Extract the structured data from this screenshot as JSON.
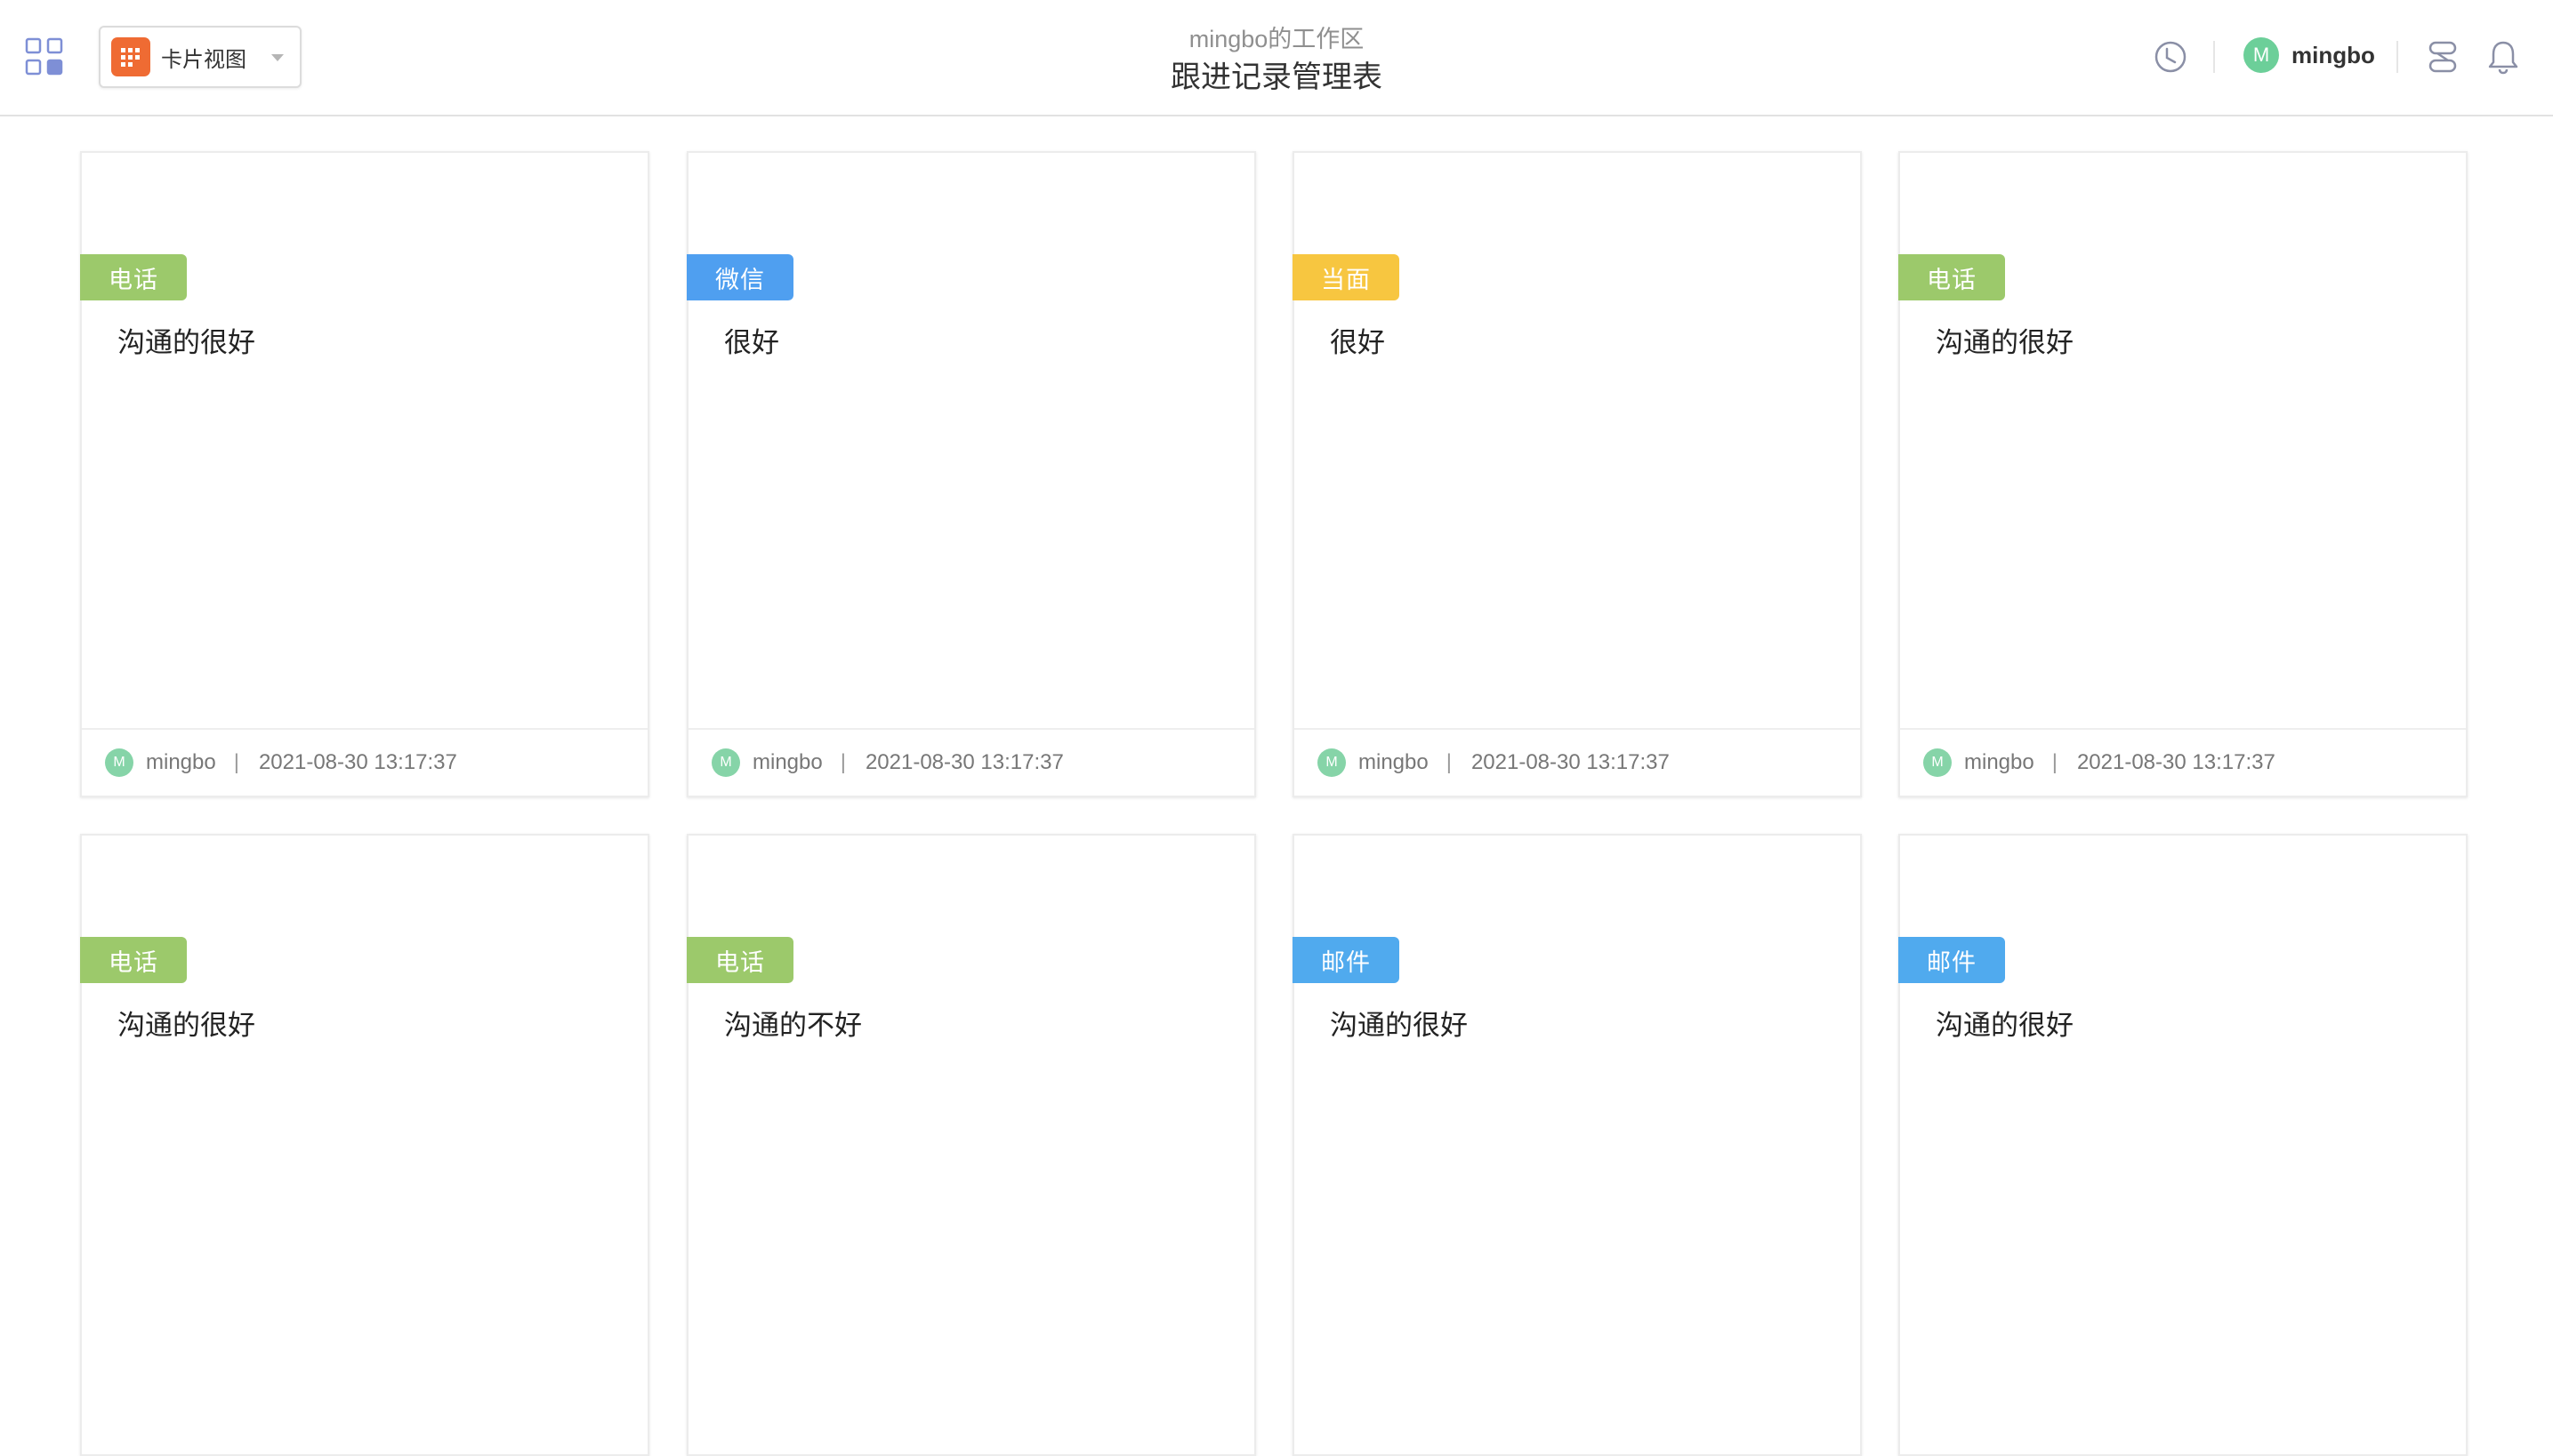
{
  "header": {
    "view_selector": {
      "label": "卡片视图"
    },
    "workspace_name": "mingbo的工作区",
    "table_title": "跟进记录管理表",
    "user": {
      "initial": "M",
      "name": "mingbo"
    }
  },
  "colors": {
    "电话": "#9cc96b",
    "微信": "#4f9ff0",
    "当面": "#f7c640",
    "邮件": "#50aaee"
  },
  "cards": [
    {
      "tag": "电话",
      "text": "沟通的很好",
      "footer": {
        "initial": "M",
        "user": "mingbo",
        "separator": "|",
        "time": "2021-08-30 13:17:37"
      }
    },
    {
      "tag": "微信",
      "text": "很好",
      "footer": {
        "initial": "M",
        "user": "mingbo",
        "separator": "|",
        "time": "2021-08-30 13:17:37"
      }
    },
    {
      "tag": "当面",
      "text": "很好",
      "footer": {
        "initial": "M",
        "user": "mingbo",
        "separator": "|",
        "time": "2021-08-30 13:17:37"
      }
    },
    {
      "tag": "电话",
      "text": "沟通的很好",
      "footer": {
        "initial": "M",
        "user": "mingbo",
        "separator": "|",
        "time": "2021-08-30 13:17:37"
      }
    },
    {
      "tag": "电话",
      "text": "沟通的很好"
    },
    {
      "tag": "电话",
      "text": "沟通的不好"
    },
    {
      "tag": "邮件",
      "text": "沟通的很好"
    },
    {
      "tag": "邮件",
      "text": "沟通的很好"
    }
  ],
  "icons": {
    "apps": "grid-apps-icon",
    "view": "card-view-icon",
    "history": "history-icon",
    "integration": "integration-icon",
    "notification": "bell-icon"
  }
}
